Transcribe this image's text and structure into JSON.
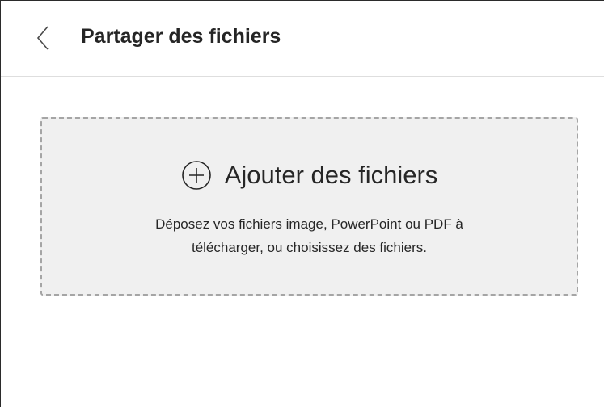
{
  "header": {
    "title": "Partager des fichiers",
    "back_icon": "chevron-left-icon"
  },
  "dropzone": {
    "icon": "plus-circle-icon",
    "action_label": "Ajouter des fichiers",
    "hint_line1": "Déposez vos fichiers image, PowerPoint ou PDF à",
    "hint_line2": "télécharger, ou choisissez des fichiers."
  },
  "colors": {
    "text": "#262626",
    "dropzone_background": "#f0f0f0",
    "dropzone_border": "#a5a5a5",
    "divider": "#dedede"
  }
}
